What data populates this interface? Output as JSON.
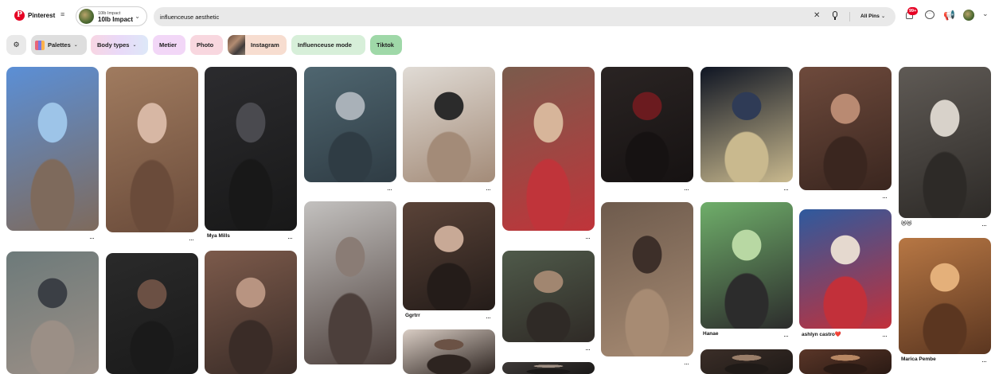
{
  "app": {
    "name": "Pinterest"
  },
  "board": {
    "subtitle": "10lb Impact",
    "name": "10lb Impact"
  },
  "search": {
    "value": "influenceuse aesthetic",
    "scope": "All Pins"
  },
  "notifications": {
    "badge": "99+"
  },
  "filters": [
    {
      "label": "Palettes",
      "has_dropdown": true
    },
    {
      "label": "Body types",
      "has_dropdown": true
    },
    {
      "label": "Metier",
      "has_dropdown": false
    },
    {
      "label": "Photo",
      "has_dropdown": false
    },
    {
      "label": "Instagram",
      "has_dropdown": false
    },
    {
      "label": "Influenceuse mode",
      "has_dropdown": false
    },
    {
      "label": "Tiktok",
      "has_dropdown": false
    }
  ],
  "pins": {
    "c1": [
      {
        "caption": "",
        "colors": [
          "#5b8fd6",
          "#9dc4e8",
          "#7e6a5c"
        ]
      },
      {
        "caption": "",
        "colors": [
          "#6d7a7a",
          "#3b3f45",
          "#9b8f86"
        ]
      }
    ],
    "c2": [
      {
        "caption": "",
        "colors": [
          "#a07b5f",
          "#d7b7a4",
          "#6a4b3a"
        ]
      },
      {
        "caption": "",
        "colors": [
          "#2a2a2a",
          "#6b5044",
          "#1a1a1a"
        ]
      }
    ],
    "c3": [
      {
        "caption": "Mya Mills",
        "colors": [
          "#2b2b2e",
          "#4a4a4f",
          "#181818"
        ]
      },
      {
        "caption": "",
        "colors": [
          "#7c5a4b",
          "#b89481",
          "#3a2c27"
        ]
      }
    ],
    "c4": [
      {
        "caption": "",
        "colors": [
          "#4f6670",
          "#a9b1b8",
          "#2f3c44"
        ]
      },
      {
        "caption": "",
        "colors": [
          "#c3c1bf",
          "#8a7c75",
          "#4c3f3b"
        ]
      }
    ],
    "c5": [
      {
        "caption": "",
        "colors": [
          "#e0dbd5",
          "#2b2b2b",
          "#a38b78"
        ]
      },
      {
        "caption": "Ggrtrr",
        "colors": [
          "#5a4338",
          "#c8a996",
          "#241c19"
        ]
      },
      {
        "caption": "",
        "colors": [
          "#d9cdc4",
          "#6b5245",
          "#2d2420"
        ]
      }
    ],
    "c6": [
      {
        "caption": "",
        "colors": [
          "#7a5b4c",
          "#d7b59a",
          "#c0343a"
        ]
      },
      {
        "caption": "",
        "colors": [
          "#4f5a4a",
          "#a18670",
          "#2f2a26"
        ]
      },
      {
        "caption": "",
        "colors": [
          "#3e3a38",
          "#9e8e82",
          "#1b1918"
        ]
      }
    ],
    "c7": [
      {
        "caption": "",
        "colors": [
          "#2a2423",
          "#6b1b1f",
          "#161212"
        ]
      },
      {
        "caption": "",
        "colors": [
          "#6e5b4d",
          "#3d2f29",
          "#a78b73"
        ]
      }
    ],
    "c8": [
      {
        "caption": "",
        "colors": [
          "#0f1523",
          "#2f3b56",
          "#c9b98e"
        ]
      },
      {
        "caption": "Hanae",
        "colors": [
          "#6fae6a",
          "#b8d8a3",
          "#2c2c2c"
        ]
      },
      {
        "caption": "",
        "colors": [
          "#3b2e28",
          "#9a7e69",
          "#1f1a17"
        ]
      }
    ],
    "c9": [
      {
        "caption": "",
        "colors": [
          "#6e4a3c",
          "#b98a72",
          "#3a261f"
        ]
      },
      {
        "caption": "ashlyn castro❤️",
        "colors": [
          "#2e5a9e",
          "#e5d9cf",
          "#c2303a"
        ]
      },
      {
        "caption": "",
        "colors": [
          "#5a3628",
          "#b88763",
          "#2a1a14"
        ]
      }
    ],
    "c10": [
      {
        "caption": "😻😻",
        "colors": [
          "#5f5a55",
          "#d8d2ca",
          "#2d2a27"
        ]
      },
      {
        "caption": "Marica Pembe",
        "colors": [
          "#b77744",
          "#e4b07a",
          "#5b3620"
        ]
      }
    ]
  }
}
